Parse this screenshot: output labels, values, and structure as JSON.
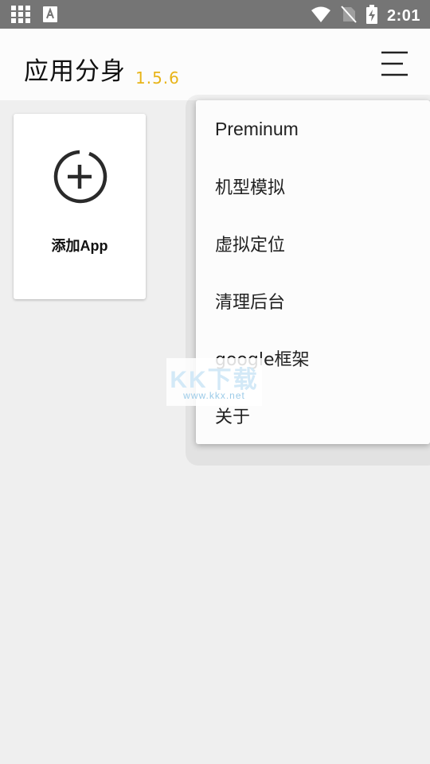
{
  "status_bar": {
    "time": "2:01",
    "left_icons": [
      "grid-icon",
      "font-a-icon"
    ],
    "right_icons": [
      "wifi-icon",
      "no-sim-icon",
      "battery-charging-icon"
    ]
  },
  "app_bar": {
    "title": "应用分身",
    "version": "1.5.6",
    "menu_icon": "hamburger-menu-icon",
    "colors": {
      "version": "#e8b418",
      "background": "#fcfcfc"
    }
  },
  "add_card": {
    "icon": "add-circle-icon",
    "label": "添加App"
  },
  "menu": {
    "items": [
      {
        "label": "Preminum"
      },
      {
        "label": "机型模拟"
      },
      {
        "label": "虚拟定位"
      },
      {
        "label": "清理后台"
      },
      {
        "label": "google框架"
      },
      {
        "label": "关于"
      }
    ]
  },
  "watermark": {
    "text": "KK下载",
    "url": "www.kkx.net"
  },
  "colors": {
    "status_bar": "#757575",
    "page_background": "#efefef"
  }
}
